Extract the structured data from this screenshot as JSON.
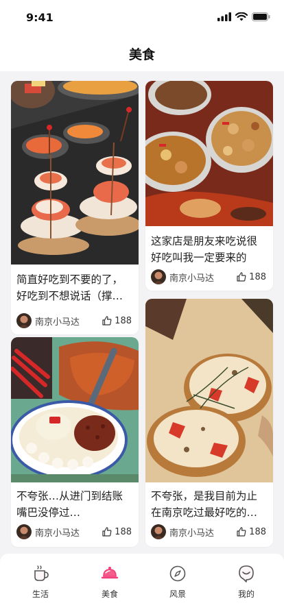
{
  "status": {
    "time": "9:41"
  },
  "nav": {
    "title": "美食"
  },
  "cards": [
    {
      "title": "简直好吃到不要的了，好吃到不想说话（撑死我",
      "author": "南京小马达",
      "likes": "188"
    },
    {
      "title": "这家店是朋友来吃说很好吃叫我一定要来的",
      "author": "南京小马达",
      "likes": "188"
    },
    {
      "title": "不夸张…从进门到结账嘴巴没停过…",
      "author": "南京小马达",
      "likes": "188"
    },
    {
      "title": "不夸张，是我目前为止在南京吃过最好吃的披萨",
      "author": "南京小马达",
      "likes": "188"
    }
  ],
  "tabs": [
    {
      "label": "生活",
      "icon": "coffee-cup-icon"
    },
    {
      "label": "美食",
      "icon": "food-dome-icon",
      "active": true
    },
    {
      "label": "风景",
      "icon": "compass-icon"
    },
    {
      "label": "我的",
      "icon": "profile-icon"
    }
  ],
  "colors": {
    "accent": "#f0407a",
    "background": "#f3f3f5"
  }
}
